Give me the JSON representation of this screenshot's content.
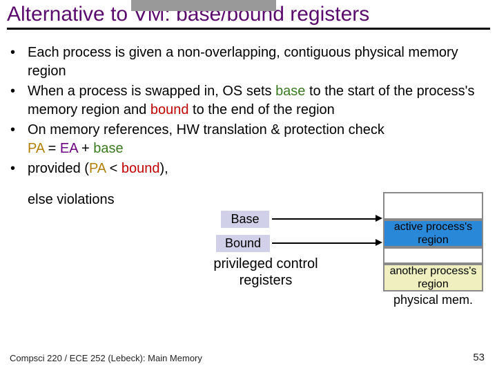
{
  "title": "Alternative to VM: base/bound registers",
  "bullets": {
    "b1": "Each process is given a non-overlapping, contiguous physical memory region",
    "b2_a": "When a process is swapped in, OS sets ",
    "b2_base": "base",
    "b2_b": " to the start of the process's memory region and ",
    "b2_bound": "bound",
    "b2_c": " to the end of the region",
    "b3_a": " On memory references, HW translation & protection check",
    "b3_pa": "PA",
    "b3_eq": " = ",
    "b3_ea": "EA",
    "b3_plus": " + ",
    "b3_base": "base",
    "b4_a": "provided (",
    "b4_pa": "PA",
    "b4_lt": " < ",
    "b4_bound": "bound",
    "b4_b": "),",
    "else": "else violations"
  },
  "diagram": {
    "base_reg": "Base",
    "bound_reg": "Bound",
    "priv_label": "privileged control registers",
    "block_active": "active process's region",
    "block_gap": "",
    "block_another": "another process's region",
    "block_phys": "physical mem."
  },
  "footer": {
    "left": "Compsci  220 / ECE 252 (Lebeck): Main Memory",
    "right": "53"
  }
}
